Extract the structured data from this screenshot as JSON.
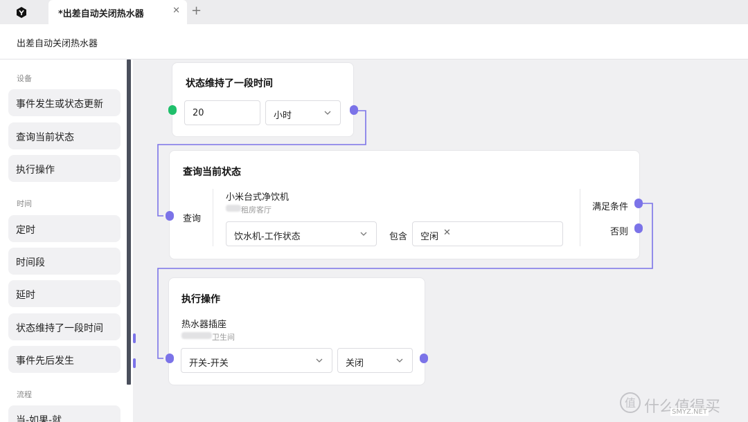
{
  "tabs": [
    {
      "title": "*出差自动关闭热水器"
    }
  ],
  "header": {
    "title": "出差自动关闭热水器"
  },
  "sidebar": {
    "sections": [
      {
        "label": "设备",
        "items": [
          "事件发生或状态更新",
          "查询当前状态",
          "执行操作"
        ]
      },
      {
        "label": "时间",
        "items": [
          "定时",
          "时间段",
          "延时",
          "状态维持了一段时间",
          "事件先后发生"
        ]
      },
      {
        "label": "流程",
        "items": [
          "当-如果-就"
        ]
      }
    ]
  },
  "nodes": {
    "duration": {
      "title": "状态维持了一段时间",
      "value": "20",
      "unit": "小时"
    },
    "query": {
      "title": "查询当前状态",
      "input_label": "查询",
      "device": "小米台式净饮机",
      "room": "租房客厅",
      "property": "饮水机-工作状态",
      "operator": "包含",
      "tag": "空闲",
      "out_true": "满足条件",
      "out_false": "否则"
    },
    "action": {
      "title": "执行操作",
      "device": "热水器插座",
      "room": "卫生间",
      "property": "开关-开关",
      "value": "关闭"
    }
  },
  "watermark": {
    "text": "什么值得买",
    "sub": "SMYZ.NET"
  },
  "colors": {
    "accent": "#7b73e8",
    "start": "#1fbf6b",
    "sidebar_scroll": "#4a4f5c"
  }
}
